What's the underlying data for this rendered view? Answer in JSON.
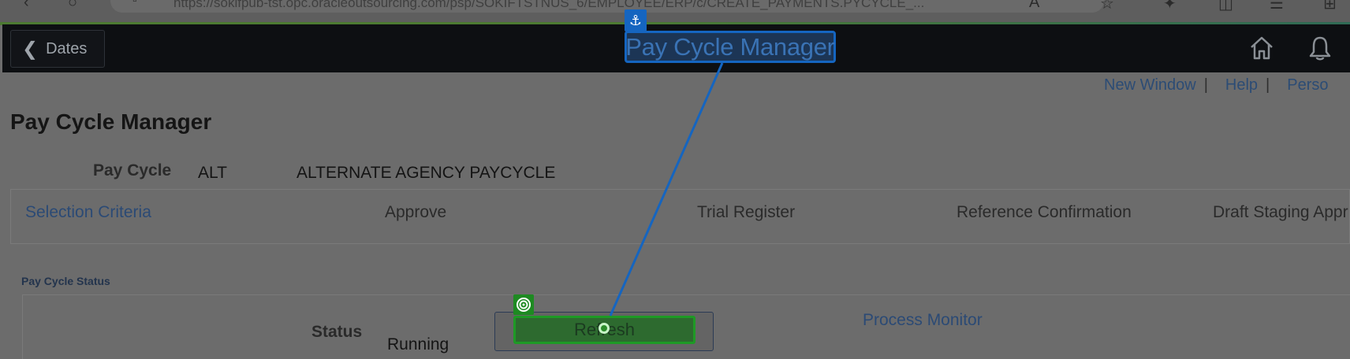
{
  "browser": {
    "url": "https://sokifpub-tst.opc.oracleoutsourcing.com/psp/SOKIFTSTNUS_6/EMPLOYEE/ERP/c/CREATE_PAYMENTS.PYCYCLE_..."
  },
  "header": {
    "back_label": "Dates",
    "title": "Pay Cycle Manager"
  },
  "utility_links": {
    "new_window": "New Window",
    "sep1": "|",
    "help": "Help",
    "sep2": "|",
    "personalize": "Perso"
  },
  "page": {
    "title": "Pay Cycle Manager",
    "pay_cycle_label": "Pay Cycle",
    "pay_cycle_code": "ALT",
    "pay_cycle_desc": "ALTERNATE AGENCY PAYCYCLE"
  },
  "tabs": [
    {
      "label": "Selection Criteria"
    },
    {
      "label": "Approve"
    },
    {
      "label": "Trial Register"
    },
    {
      "label": "Reference Confirmation"
    },
    {
      "label": "Draft Staging Appr"
    }
  ],
  "status_section": {
    "label": "Pay Cycle Status",
    "status_label": "Status",
    "status_value": "Running",
    "refresh_label": "Refresh",
    "process_monitor": "Process Monitor"
  },
  "icons": {
    "anchor": "anchor-icon",
    "target": "target-icon",
    "home": "home-icon",
    "bell": "bell-icon"
  },
  "colors": {
    "header_bg": "#0d0f12",
    "link": "#2b4a75",
    "highlight_blue": "#1565c0",
    "highlight_green": "#1e9a25"
  }
}
